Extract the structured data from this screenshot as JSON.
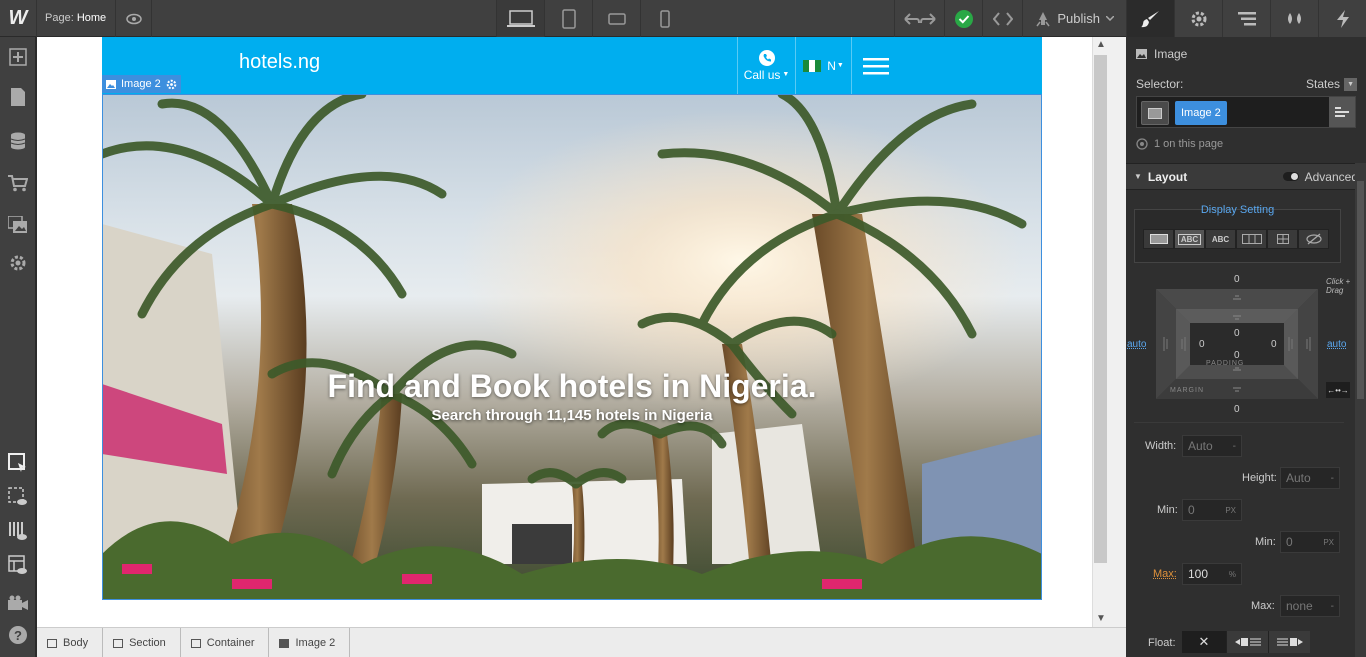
{
  "topbar": {
    "page_label": "Page:",
    "page_name": "Home",
    "publish_label": "Publish"
  },
  "site": {
    "logo": "hotels.ng",
    "call_label": "Call us",
    "lang_label": "N",
    "hero_title": "Find and Book hotels in Nigeria.",
    "hero_subtitle": "Search through 11,145 hotels in Nigeria",
    "selection_tag": "Image 2"
  },
  "breadcrumbs": [
    "Body",
    "Section",
    "Container",
    "Image 2"
  ],
  "panel": {
    "element_type": "Image",
    "selector_label": "Selector:",
    "states_label": "States",
    "selector_class": "Image 2",
    "count_text": "1 on this page",
    "layout_label": "Layout",
    "advanced_label": "Advanced",
    "display_setting_label": "Display Setting",
    "display_options": [
      "block",
      "ABC",
      "ABC",
      "flex",
      "grid",
      "none"
    ],
    "margin_top": "0",
    "margin_bottom": "0",
    "margin_left": "auto",
    "margin_right": "auto",
    "padding_top": "0",
    "padding_bottom": "0",
    "padding_left": "0",
    "padding_right": "0",
    "padding_label": "PADDING",
    "margin_label": "MARGIN",
    "click_drag_hint": "Click + Drag",
    "width_label": "Width:",
    "width_value": "Auto",
    "height_label": "Height:",
    "height_value": "Auto",
    "min_label": "Min:",
    "min_width_value": "0",
    "min_height_value": "0",
    "unit_px": "PX",
    "max_label": "Max:",
    "max_width_value": "100",
    "unit_pct": "%",
    "max_height_value": "none",
    "dash": "-",
    "float_label": "Float:"
  },
  "colors": {
    "site_header": "#00aeef",
    "selection": "#3d8fde",
    "max_label": "#e0923a",
    "publish_check": "#29a846"
  }
}
